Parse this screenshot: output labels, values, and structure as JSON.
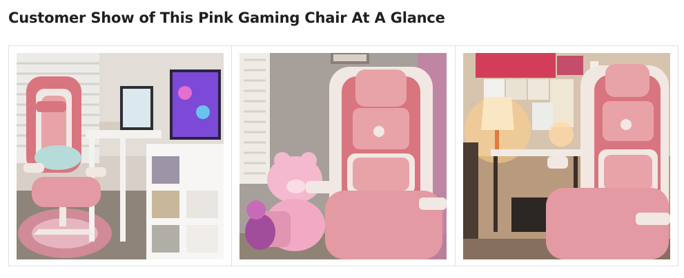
{
  "section": {
    "title": "Customer Show of This Pink Gaming Chair At A Glance"
  },
  "gallery": {
    "photos": [
      {
        "subject": "pink gaming chair in room with white desk, monitor and RGB PC"
      },
      {
        "subject": "pink gaming chair beside pink teddy bear and purple pony plush"
      },
      {
        "subject": "pink gaming chair beside lamp-lit desk with anime posters"
      }
    ]
  },
  "colors": {
    "chair_pink": "#d9757f",
    "chair_light_pink": "#e8a3a8",
    "chair_white": "#f1e8e3"
  }
}
